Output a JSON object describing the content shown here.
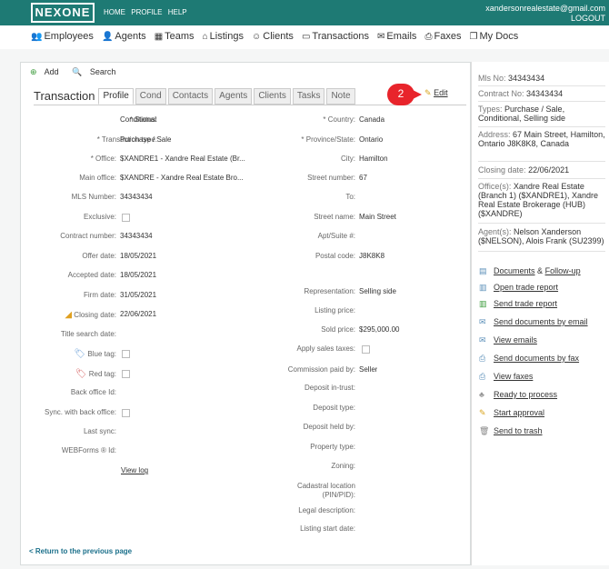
{
  "header": {
    "logo": "NEXONE",
    "nav": [
      "HOME",
      "PROFILE",
      "HELP"
    ],
    "email": "xandersonrealestate@gmail.com",
    "logout": "LOGOUT"
  },
  "menu": [
    {
      "icon": "employees-icon",
      "label": "Employees"
    },
    {
      "icon": "agents-icon",
      "label": "Agents"
    },
    {
      "icon": "teams-icon",
      "label": "Teams"
    },
    {
      "icon": "listings-icon",
      "label": "Listings"
    },
    {
      "icon": "clients-icon",
      "label": "Clients"
    },
    {
      "icon": "transactions-icon",
      "label": "Transactions"
    },
    {
      "icon": "emails-icon",
      "label": "Emails"
    },
    {
      "icon": "faxes-icon",
      "label": "Faxes"
    },
    {
      "icon": "mydocs-icon",
      "label": "My Docs"
    }
  ],
  "actions": {
    "add": "Add",
    "search": "Search"
  },
  "tabs": {
    "title": "Transaction",
    "items": [
      "Profile",
      "Cond",
      "Contacts",
      "Agents",
      "Clients",
      "Tasks",
      "Note"
    ],
    "active": "Profile"
  },
  "badge": "2",
  "edit": "Edit",
  "left_fields": {
    "status": {
      "label": "* Status:",
      "value": "Conditional"
    },
    "transaction_type": {
      "label": "* Transaction type:",
      "value": "Purchase / Sale"
    },
    "office": {
      "label": "* Office:",
      "value": "$XANDRE1 - Xandre Real Estate (Br..."
    },
    "main_office": {
      "label": "Main office:",
      "value": "$XANDRE - Xandre Real Estate Bro..."
    },
    "mls_number": {
      "label": "MLS Number:",
      "value": "34343434"
    },
    "exclusive": {
      "label": "Exclusive:",
      "value": ""
    },
    "contract_number": {
      "label": "Contract number:",
      "value": "34343434"
    },
    "offer_date": {
      "label": "Offer date:",
      "value": "18/05/2021"
    },
    "accepted_date": {
      "label": "Accepted date:",
      "value": "18/05/2021"
    },
    "firm_date": {
      "label": "Firm date:",
      "value": "31/05/2021"
    },
    "closing_date": {
      "label": "Closing date:",
      "value": "22/06/2021"
    },
    "title_search_date": {
      "label": "Title search date:",
      "value": ""
    },
    "blue_tag": {
      "label": "Blue tag:",
      "value": ""
    },
    "red_tag": {
      "label": "Red tag:",
      "value": ""
    },
    "back_office_id": {
      "label": "Back office Id:",
      "value": ""
    },
    "sync_back_office": {
      "label": "Sync. with back office:",
      "value": ""
    },
    "last_sync": {
      "label": "Last sync:",
      "value": ""
    },
    "webforms_id": {
      "label": "WEBForms ® Id:",
      "value": ""
    }
  },
  "view_log": "View log",
  "right_fields": {
    "country": {
      "label": "* Country:",
      "value": "Canada"
    },
    "province": {
      "label": "* Province/State:",
      "value": "Ontario"
    },
    "city": {
      "label": "City:",
      "value": "Hamilton"
    },
    "street_number": {
      "label": "Street number:",
      "value": "67"
    },
    "to": {
      "label": "To:",
      "value": ""
    },
    "street_name": {
      "label": "Street name:",
      "value": "Main Street"
    },
    "apt_suite": {
      "label": "Apt/Suite #:",
      "value": ""
    },
    "postal_code": {
      "label": "Postal code:",
      "value": "J8K8K8"
    },
    "representation": {
      "label": "Representation:",
      "value": "Selling side"
    },
    "listing_price": {
      "label": "Listing price:",
      "value": ""
    },
    "sold_price": {
      "label": "Sold price:",
      "value": "$295,000.00"
    },
    "apply_sales_taxes": {
      "label": "Apply sales taxes:",
      "value": ""
    },
    "commission_paid_by": {
      "label": "Commission paid by:",
      "value": "Seller"
    },
    "deposit_in_trust": {
      "label": "Deposit in-trust:",
      "value": ""
    },
    "deposit_type": {
      "label": "Deposit type:",
      "value": ""
    },
    "deposit_held_by": {
      "label": "Deposit held by:",
      "value": ""
    },
    "property_type": {
      "label": "Property type:",
      "value": ""
    },
    "zoning": {
      "label": "Zoning:",
      "value": ""
    },
    "cadastral": {
      "label": "Cadastral location (PIN/PID):",
      "value": ""
    },
    "legal_description": {
      "label": "Legal description:",
      "value": ""
    },
    "listing_start_date": {
      "label": "Listing start date:",
      "value": ""
    }
  },
  "return_link": "< Return to the previous page",
  "sidebar": {
    "mls_label": "Mls No:",
    "mls_value": "34343434",
    "contract_label": "Contract No:",
    "contract_value": "34343434",
    "types_label": "Types:",
    "types_value": "Purchase / Sale, Conditional, Selling side",
    "address_label": "Address:",
    "address_value": "67 Main Street, Hamilton, Ontario J8K8K8, Canada",
    "closing_label": "Closing date:",
    "closing_value": "22/06/2021",
    "office_label": "Office(s):",
    "office_value": "Xandre Real Estate (Branch 1) ($XANDRE1), Xandre Real Estate Brokerage (HUB) ($XANDRE)",
    "agents_label": "Agent(s):",
    "agents_value": "Nelson Xanderson ($NELSON), Alois Frank (SU2399)",
    "links": [
      {
        "icon": "documents-icon",
        "label": "Documents",
        "amp": "&",
        "label2": "Follow-up"
      },
      {
        "icon": "open-trade-report-icon",
        "label": "Open trade report"
      },
      {
        "icon": "send-trade-report-icon",
        "label": "Send trade report"
      },
      {
        "icon": "send-email-icon",
        "label": "Send documents by email"
      },
      {
        "icon": "view-emails-icon",
        "label": "View emails"
      },
      {
        "icon": "send-fax-icon",
        "label": "Send documents by fax"
      },
      {
        "icon": "view-faxes-icon",
        "label": "View faxes"
      },
      {
        "icon": "ready-process-icon",
        "label": "Ready to process"
      },
      {
        "icon": "start-approval-icon",
        "label": "Start approval"
      },
      {
        "icon": "trash-icon",
        "label": "Send to trash"
      }
    ]
  }
}
